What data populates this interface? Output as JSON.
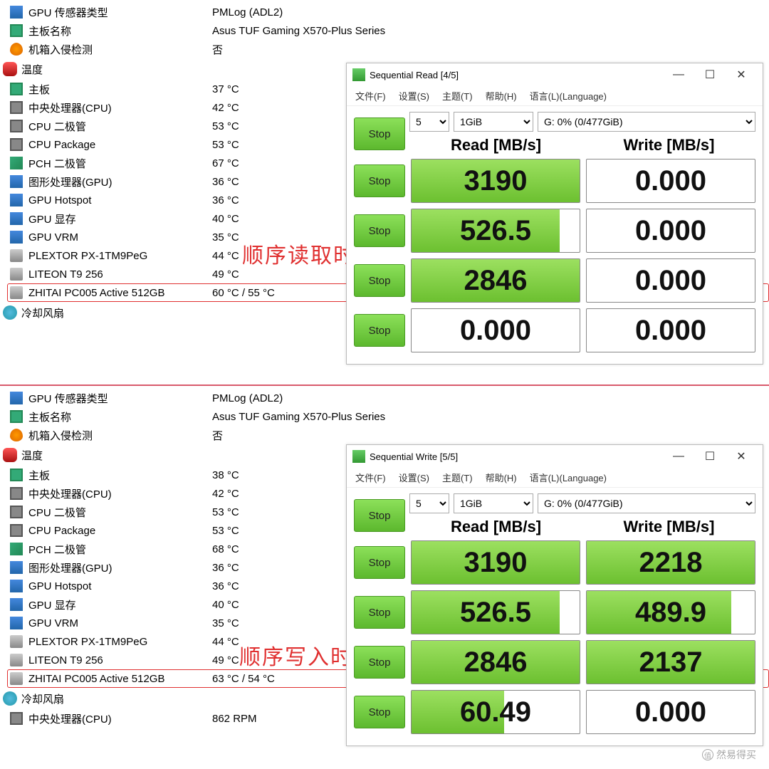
{
  "top": {
    "info": [
      {
        "icon": "ic-gpu",
        "label": "GPU 传感器类型",
        "value": "PMLog (ADL2)"
      },
      {
        "icon": "ic-mb",
        "label": "主板名称",
        "value": "Asus TUF Gaming X570-Plus Series"
      },
      {
        "icon": "ic-shield",
        "label": "机箱入侵检测",
        "value": "否"
      }
    ],
    "temp_header": "温度",
    "temps": [
      {
        "icon": "ic-mb",
        "label": "主板",
        "value": "37 °C"
      },
      {
        "icon": "ic-cpu",
        "label": "中央处理器(CPU)",
        "value": "42 °C"
      },
      {
        "icon": "ic-cpu",
        "label": "CPU 二极管",
        "value": "53 °C"
      },
      {
        "icon": "ic-cpu",
        "label": "CPU Package",
        "value": "53 °C"
      },
      {
        "icon": "ic-chip",
        "label": "PCH 二极管",
        "value": "67 °C"
      },
      {
        "icon": "ic-gpu",
        "label": "图形处理器(GPU)",
        "value": "36 °C"
      },
      {
        "icon": "ic-gpu",
        "label": "GPU Hotspot",
        "value": "36 °C"
      },
      {
        "icon": "ic-gpu",
        "label": "GPU 显存",
        "value": "40 °C"
      },
      {
        "icon": "ic-gpu",
        "label": "GPU VRM",
        "value": "35 °C"
      },
      {
        "icon": "ic-disk",
        "label": "PLEXTOR PX-1TM9PeG",
        "value": "44 °C"
      },
      {
        "icon": "ic-disk",
        "label": "LITEON T9  256",
        "value": "49 °C"
      },
      {
        "icon": "ic-disk",
        "label": "ZHITAI PC005 Active 512GB",
        "value": "60 °C / 55 °C",
        "hl": true
      }
    ],
    "fan_header": "冷却风扇",
    "annotation": "顺序读取时",
    "cdm": {
      "title": "Sequential Read [4/5]",
      "menu": [
        "文件(F)",
        "设置(S)",
        "主题(T)",
        "帮助(H)",
        "语言(L)(Language)"
      ],
      "runs": "5",
      "size": "1GiB",
      "drive": "G: 0% (0/477GiB)",
      "stop": "Stop",
      "hdr_read": "Read [MB/s]",
      "hdr_write": "Write [MB/s]",
      "rows": [
        {
          "read": "3190",
          "rbar": 100,
          "write": "0.000",
          "wbar": 0
        },
        {
          "read": "526.5",
          "rbar": 88,
          "write": "0.000",
          "wbar": 0
        },
        {
          "read": "2846",
          "rbar": 100,
          "write": "0.000",
          "wbar": 0
        },
        {
          "read": "0.000",
          "rbar": 0,
          "write": "0.000",
          "wbar": 0
        }
      ]
    }
  },
  "bot": {
    "info": [
      {
        "icon": "ic-gpu",
        "label": "GPU 传感器类型",
        "value": "PMLog (ADL2)"
      },
      {
        "icon": "ic-mb",
        "label": "主板名称",
        "value": "Asus TUF Gaming X570-Plus Series"
      },
      {
        "icon": "ic-shield",
        "label": "机箱入侵检测",
        "value": "否"
      }
    ],
    "temp_header": "温度",
    "temps": [
      {
        "icon": "ic-mb",
        "label": "主板",
        "value": "38 °C"
      },
      {
        "icon": "ic-cpu",
        "label": "中央处理器(CPU)",
        "value": "42 °C"
      },
      {
        "icon": "ic-cpu",
        "label": "CPU 二极管",
        "value": "53 °C"
      },
      {
        "icon": "ic-cpu",
        "label": "CPU Package",
        "value": "53 °C"
      },
      {
        "icon": "ic-chip",
        "label": "PCH 二极管",
        "value": "68 °C"
      },
      {
        "icon": "ic-gpu",
        "label": "图形处理器(GPU)",
        "value": "36 °C"
      },
      {
        "icon": "ic-gpu",
        "label": "GPU Hotspot",
        "value": "36 °C"
      },
      {
        "icon": "ic-gpu",
        "label": "GPU 显存",
        "value": "40 °C"
      },
      {
        "icon": "ic-gpu",
        "label": "GPU VRM",
        "value": "35 °C"
      },
      {
        "icon": "ic-disk",
        "label": "PLEXTOR PX-1TM9PeG",
        "value": "44 °C"
      },
      {
        "icon": "ic-disk",
        "label": "LITEON T9  256",
        "value": "49 °C"
      },
      {
        "icon": "ic-disk",
        "label": "ZHITAI PC005 Active 512GB",
        "value": "63 °C / 54 °C",
        "hl": true
      }
    ],
    "fan_header": "冷却风扇",
    "fan_rows": [
      {
        "icon": "ic-cpu",
        "label": "中央处理器(CPU)",
        "value": "862 RPM"
      }
    ],
    "annotation": "顺序写入时",
    "cdm": {
      "title": "Sequential Write [5/5]",
      "menu": [
        "文件(F)",
        "设置(S)",
        "主题(T)",
        "帮助(H)",
        "语言(L)(Language)"
      ],
      "runs": "5",
      "size": "1GiB",
      "drive": "G: 0% (0/477GiB)",
      "stop": "Stop",
      "hdr_read": "Read [MB/s]",
      "hdr_write": "Write [MB/s]",
      "rows": [
        {
          "read": "3190",
          "rbar": 100,
          "write": "2218",
          "wbar": 100
        },
        {
          "read": "526.5",
          "rbar": 88,
          "write": "489.9",
          "wbar": 86
        },
        {
          "read": "2846",
          "rbar": 100,
          "write": "2137",
          "wbar": 100
        },
        {
          "read": "60.49",
          "rbar": 55,
          "write": "0.000",
          "wbar": 0
        }
      ]
    }
  },
  "watermark": "然易得买"
}
